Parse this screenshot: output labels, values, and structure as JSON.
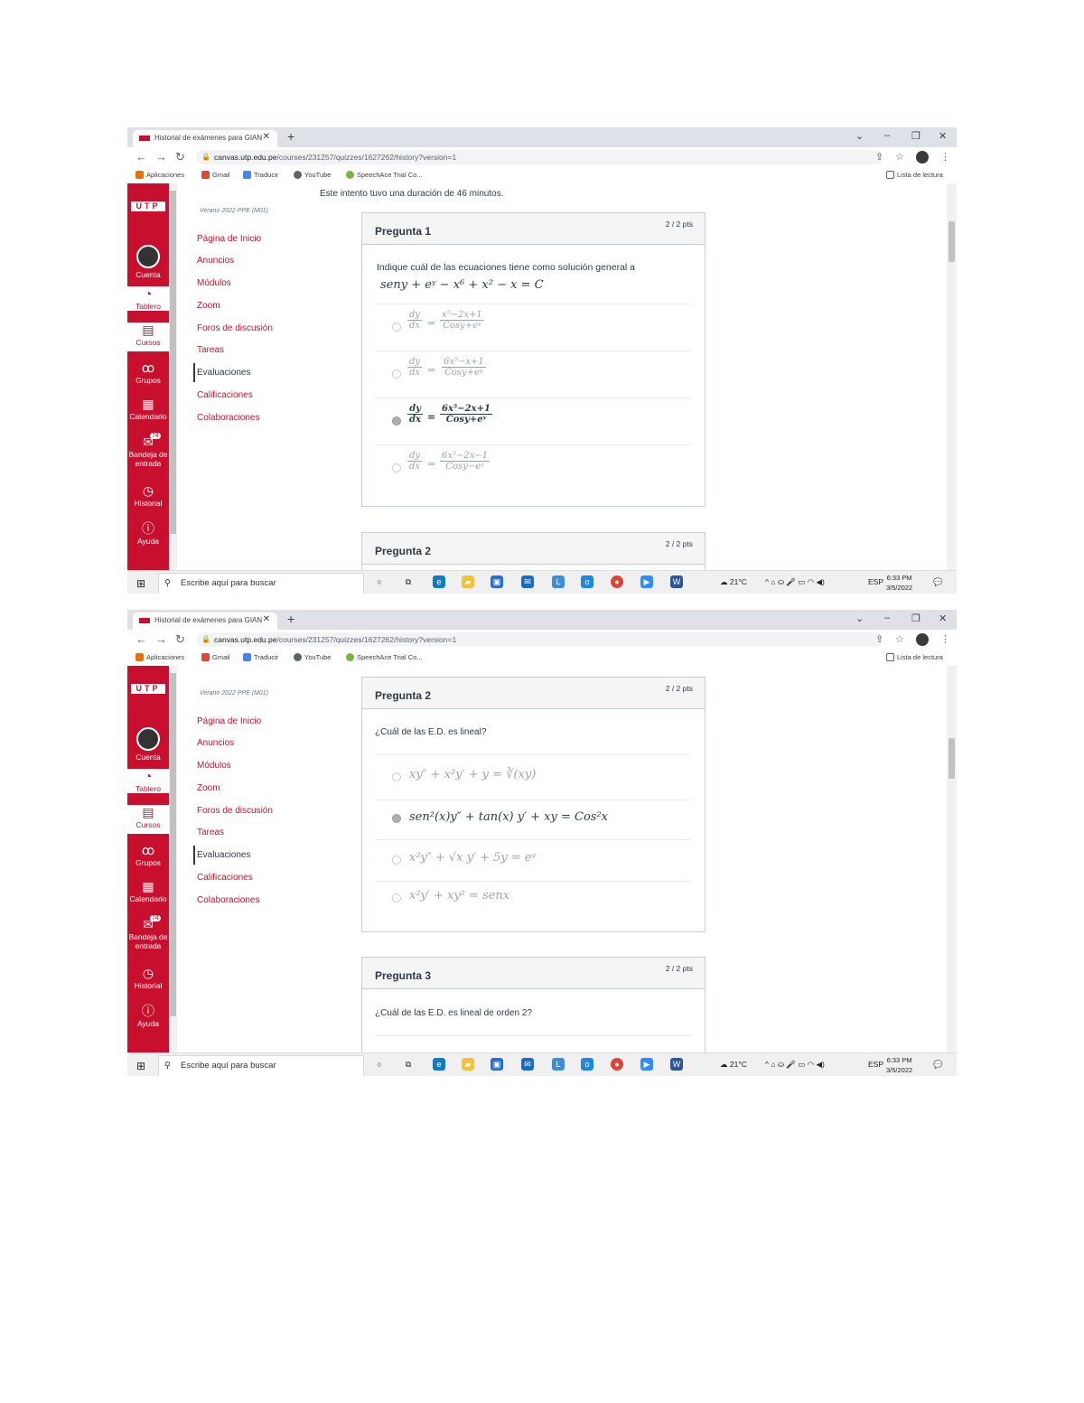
{
  "browser": {
    "tab_title": "Historial de exámenes para GIAN",
    "tab_close": "✕",
    "new_tab": "+",
    "url_host": "canvas.utp.edu.pe",
    "url_path": "/courses/231257/quizzes/1627262/history?version=1",
    "bookmarks": [
      "Aplicaciones",
      "Gmail",
      "Traducir",
      "YouTube",
      "SpeechAce Trial Co..."
    ],
    "reading_list": "Lista de lectura"
  },
  "rail": {
    "logo": "UTP",
    "items": [
      "Cuenta",
      "Tablero",
      "Cursos",
      "Grupos",
      "Calendario",
      "Bandeja de entrada",
      "Historial",
      "Ayuda"
    ],
    "inbox_badge": "74"
  },
  "course": {
    "term": "Verano 2022 PPE (M01)",
    "nav": [
      "Página de Inicio",
      "Anuncios",
      "Módulos",
      "Zoom",
      "Foros de discusión",
      "Tareas",
      "Evaluaciones",
      "Calificaciones",
      "Colaboraciones"
    ],
    "current": "Evaluaciones"
  },
  "quiz": {
    "duration_note": "Este intento tuvo una duración de 46 minutos.",
    "q1": {
      "title": "Pregunta 1",
      "points": "2 / 2 pts",
      "prompt": "Indique cuál de las ecuaciones tiene como solución general a",
      "equation": "seny + eʸ − x⁶ + x² − x = C",
      "answers": [
        {
          "lhs_n": "dy",
          "lhs_d": "dx",
          "rhs_n": "x⁵−2x+1",
          "rhs_d": "Cosy+eʸ",
          "selected": false
        },
        {
          "lhs_n": "dy",
          "lhs_d": "dx",
          "rhs_n": "6x⁵−x+1",
          "rhs_d": "Cosy+eʸ",
          "selected": false
        },
        {
          "lhs_n": "dy",
          "lhs_d": "dx",
          "rhs_n": "6x⁵−2x+1",
          "rhs_d": "Cosy+eʸ",
          "selected": true
        },
        {
          "lhs_n": "dy",
          "lhs_d": "dx",
          "rhs_n": "6x⁵−2x−1",
          "rhs_d": "Cosy−eʸ",
          "selected": false
        }
      ]
    },
    "q2": {
      "title": "Pregunta 2",
      "points": "2 / 2 pts",
      "prompt": "¿Cuál de las E.D. es lineal?",
      "answers": [
        {
          "text": "xy″ + x²y′ + y = ∛(xy)",
          "selected": false
        },
        {
          "text": "sen²(x)y″ + tan(x) y′ + xy = Cos²x",
          "selected": true
        },
        {
          "text": "x²y″ + √x y′ + 5y = eʸ",
          "selected": false
        },
        {
          "text": "x²y′ + xy² = senx",
          "selected": false
        }
      ]
    },
    "q3": {
      "title": "Pregunta 3",
      "points": "2 / 2 pts",
      "prompt": "¿Cuál de las E.D. es lineal de orden 2?"
    }
  },
  "taskbar": {
    "search_placeholder": "Escribe aquí para buscar",
    "weather": "21°C",
    "lang": "ESP",
    "time": "6:33 PM",
    "date": "3/5/2022"
  }
}
